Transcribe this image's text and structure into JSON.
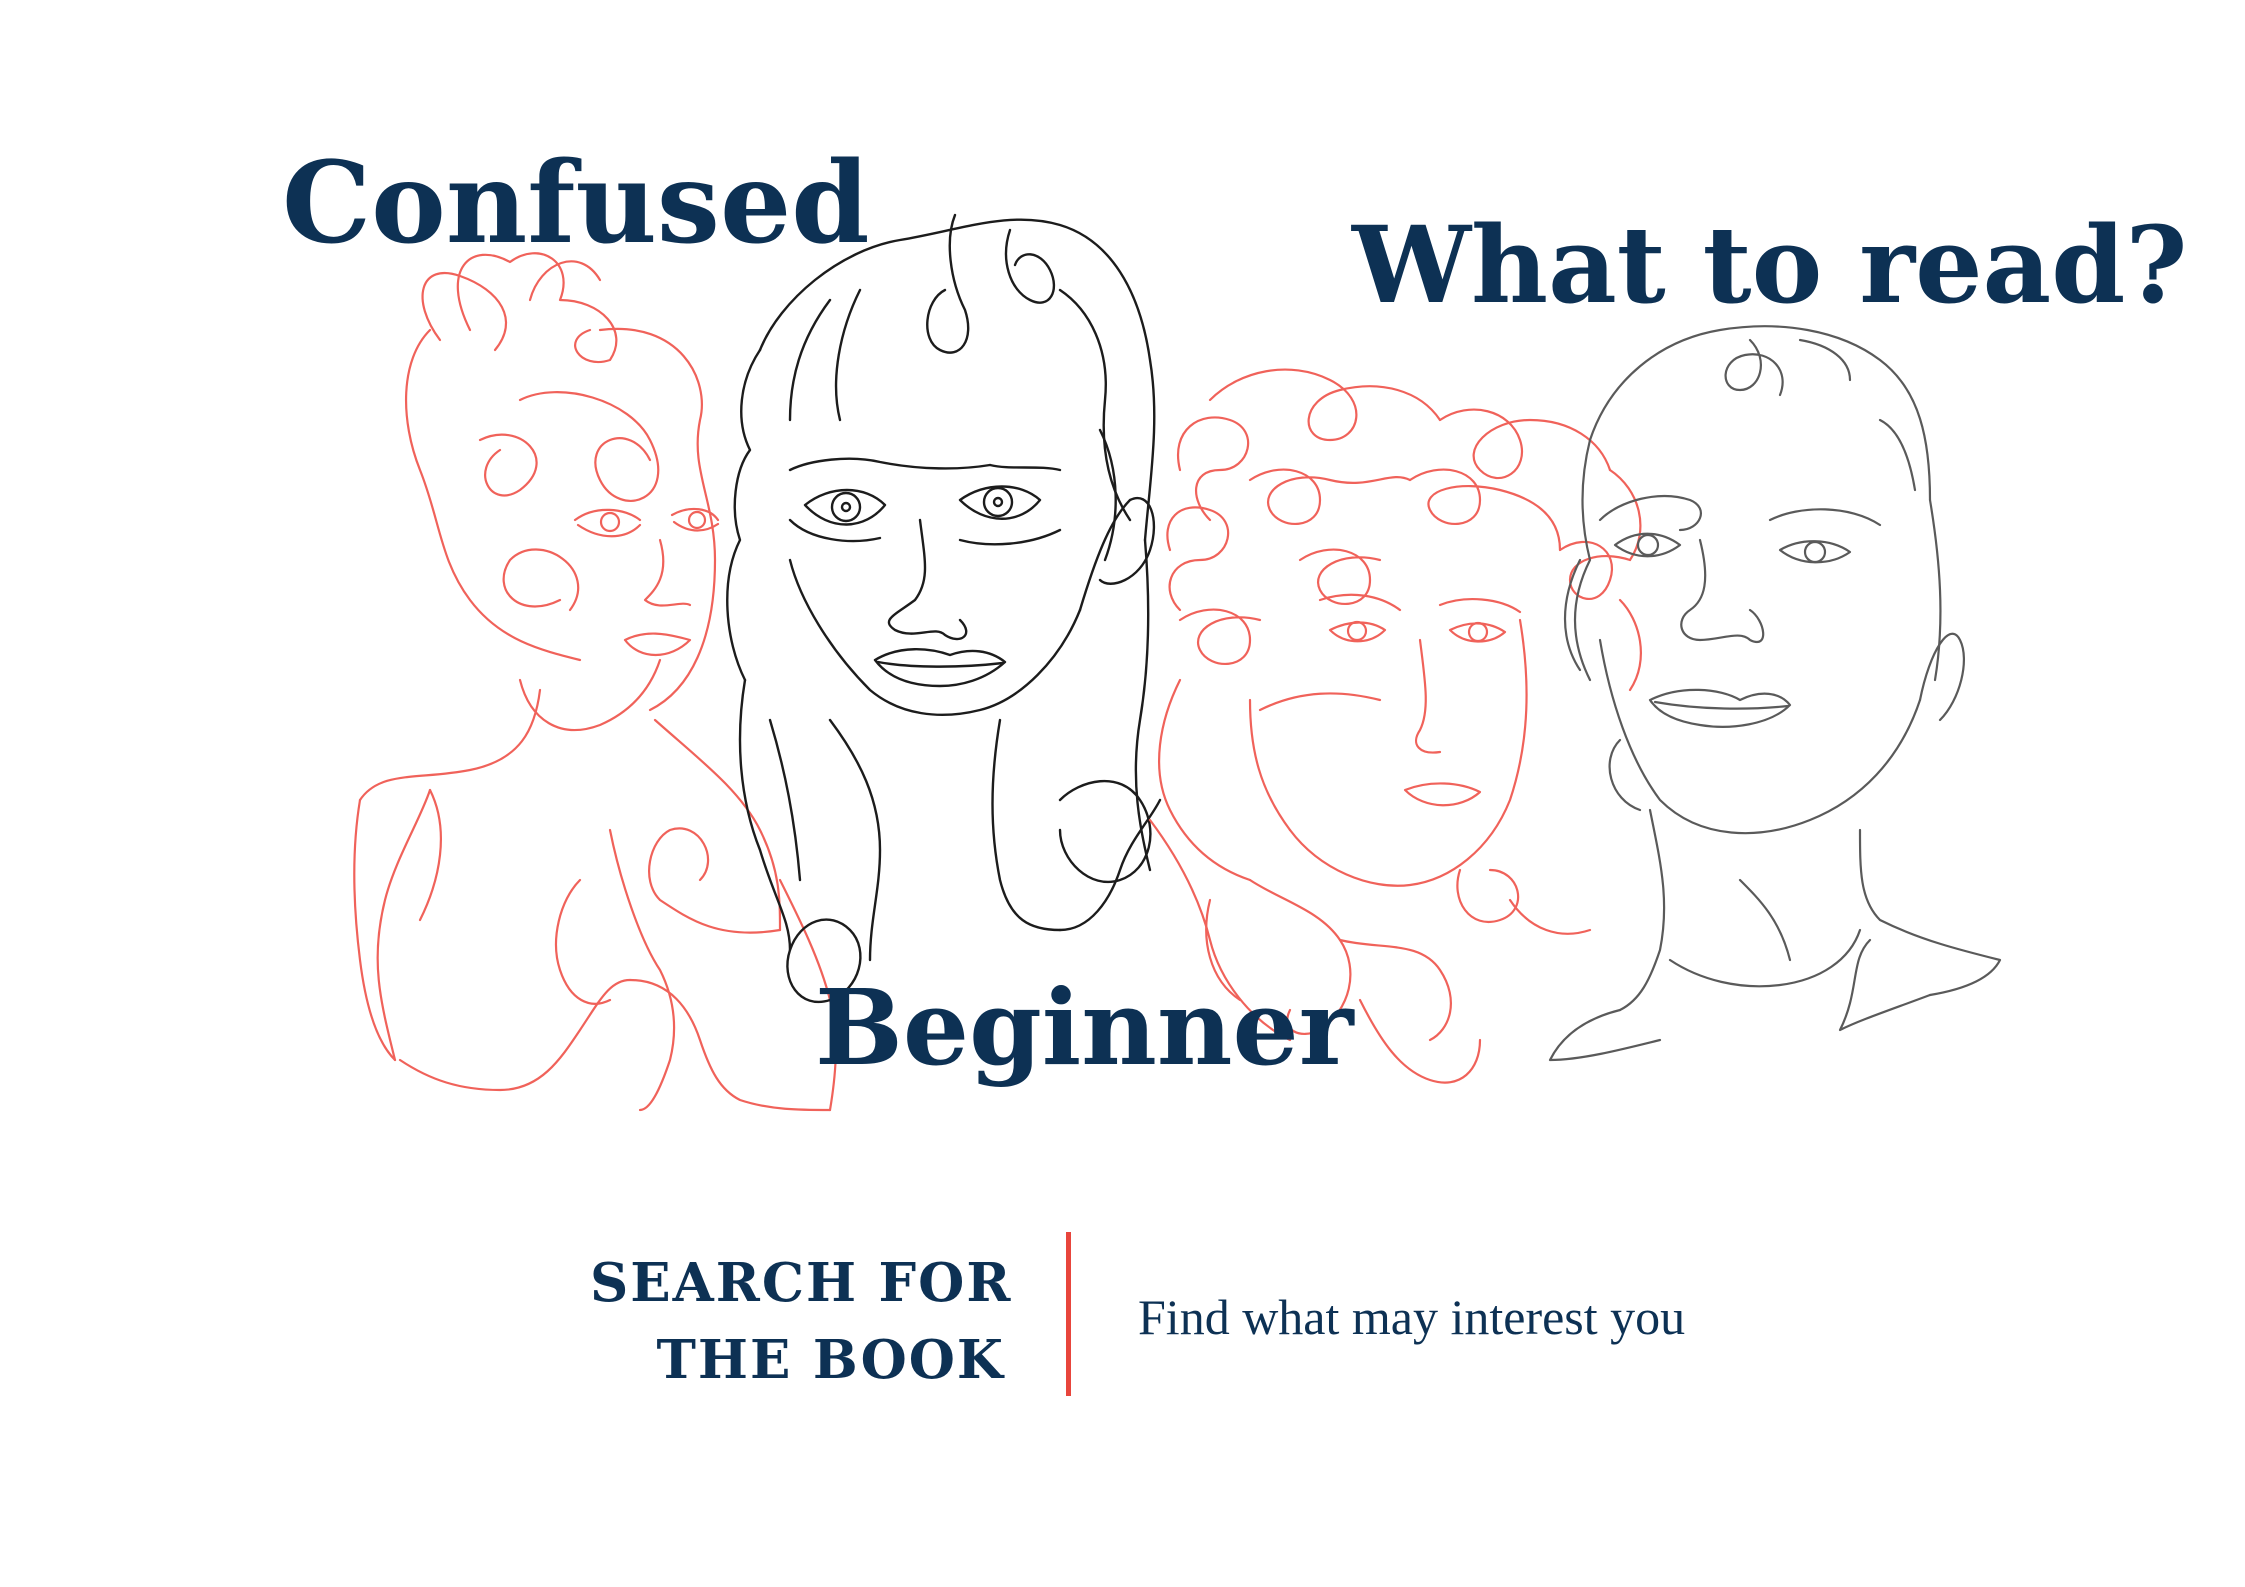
{
  "headlines": {
    "confused": "Confused",
    "what_to_read": "What to read?",
    "beginner": "Beginner"
  },
  "cta": {
    "line1": "SEARCH FOR",
    "line2": "THE BOOK"
  },
  "tagline": "Find what may interest you",
  "illustration": {
    "figures": [
      "woman-with-bun-red-line-art",
      "long-haired-woman-black-line-art",
      "curly-haired-man-red-line-art",
      "short-haired-person-gray-line-art"
    ]
  },
  "colors": {
    "text": "#0d3154",
    "accent": "#e8453c",
    "line_red": "#f0625a",
    "line_black": "#1c1c1c",
    "line_gray": "#5a5a5a",
    "background": "#ffffff"
  }
}
